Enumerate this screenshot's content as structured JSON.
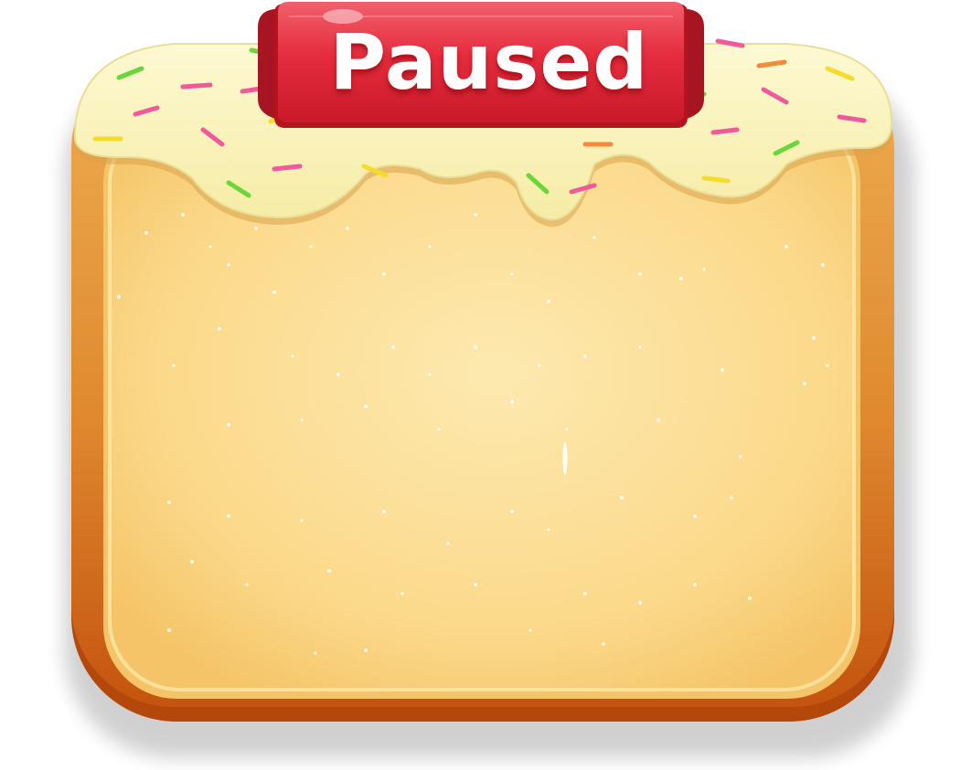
{
  "panel": {
    "title": "Paused"
  },
  "colors": {
    "frame_top": "#e8a040",
    "frame_bottom": "#c85a14",
    "panel_inner": "#fce6a4",
    "panel_edge": "#f0c060",
    "frosting": "#fbf5c0",
    "banner": "#e8283c",
    "banner_dark": "#9c0f1c",
    "sprinkle_colors": [
      "#6bd63a",
      "#f05a9c",
      "#f5dc2a",
      "#f58a3c"
    ]
  }
}
